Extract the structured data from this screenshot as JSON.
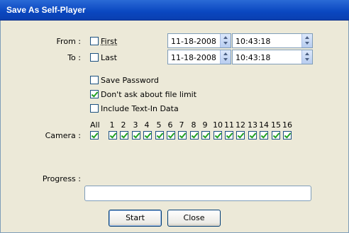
{
  "window": {
    "title": "Save As Self-Player"
  },
  "range": {
    "from_label": "From :",
    "from_check_label": "First",
    "from_checked": false,
    "from_date": "11-18-2008",
    "from_time": "10:43:18",
    "to_label": "To :",
    "to_check_label": "Last",
    "to_checked": false,
    "to_date": "11-18-2008",
    "to_time": "10:43:18"
  },
  "options": [
    {
      "label": "Save Password",
      "checked": false
    },
    {
      "label": "Don't ask about file limit",
      "checked": true
    },
    {
      "label": "Include Text-In Data",
      "checked": false
    }
  ],
  "camera": {
    "label": "Camera :",
    "all_label": "All",
    "all_checked": true,
    "numbers": [
      "1",
      "2",
      "3",
      "4",
      "5",
      "6",
      "7",
      "8",
      "9",
      "10",
      "11",
      "12",
      "13",
      "14",
      "15",
      "16"
    ],
    "checked": [
      true,
      true,
      true,
      true,
      true,
      true,
      true,
      true,
      true,
      true,
      true,
      true,
      true,
      true,
      true,
      true
    ]
  },
  "progress": {
    "label": "Progress :",
    "value": 0
  },
  "buttons": {
    "start": "Start",
    "close": "Close"
  }
}
